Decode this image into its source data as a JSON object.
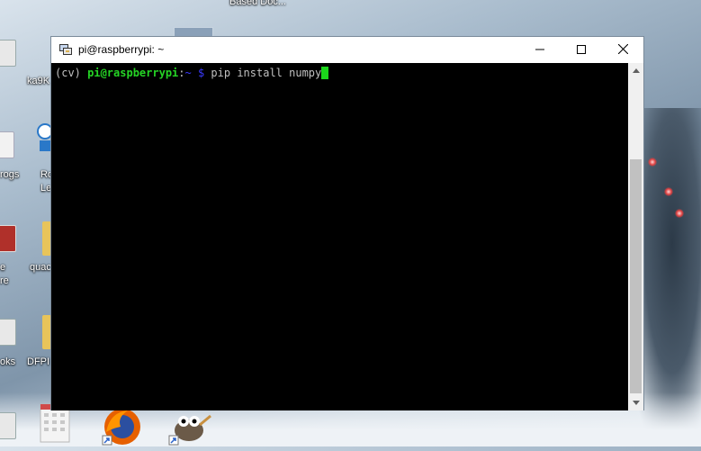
{
  "desktop": {
    "top_label": "Based Doc...",
    "icon_labels": [
      "ka9K",
      "rogs",
      "Ro",
      "Le",
      "quac",
      "e",
      "re",
      "oks",
      "DFPI"
    ]
  },
  "window": {
    "title": "pi@raspberrypi: ~",
    "app_icon": "putty-icon",
    "buttons": {
      "minimize": "minimize-icon",
      "maximize": "maximize-icon",
      "close": "close-icon"
    }
  },
  "terminal": {
    "env": "(cv) ",
    "user_host": "pi@raspberrypi",
    "colon": ":",
    "path": "~ $",
    "command": " pip install numpy"
  },
  "taskbar_icons": [
    "calendar-icon",
    "firefox-icon",
    "gimp-icon"
  ],
  "colors": {
    "terminal_bg": "#000000",
    "prompt_user": "#25d425",
    "prompt_path": "#3a3aff",
    "cursor": "#1bd61b"
  }
}
